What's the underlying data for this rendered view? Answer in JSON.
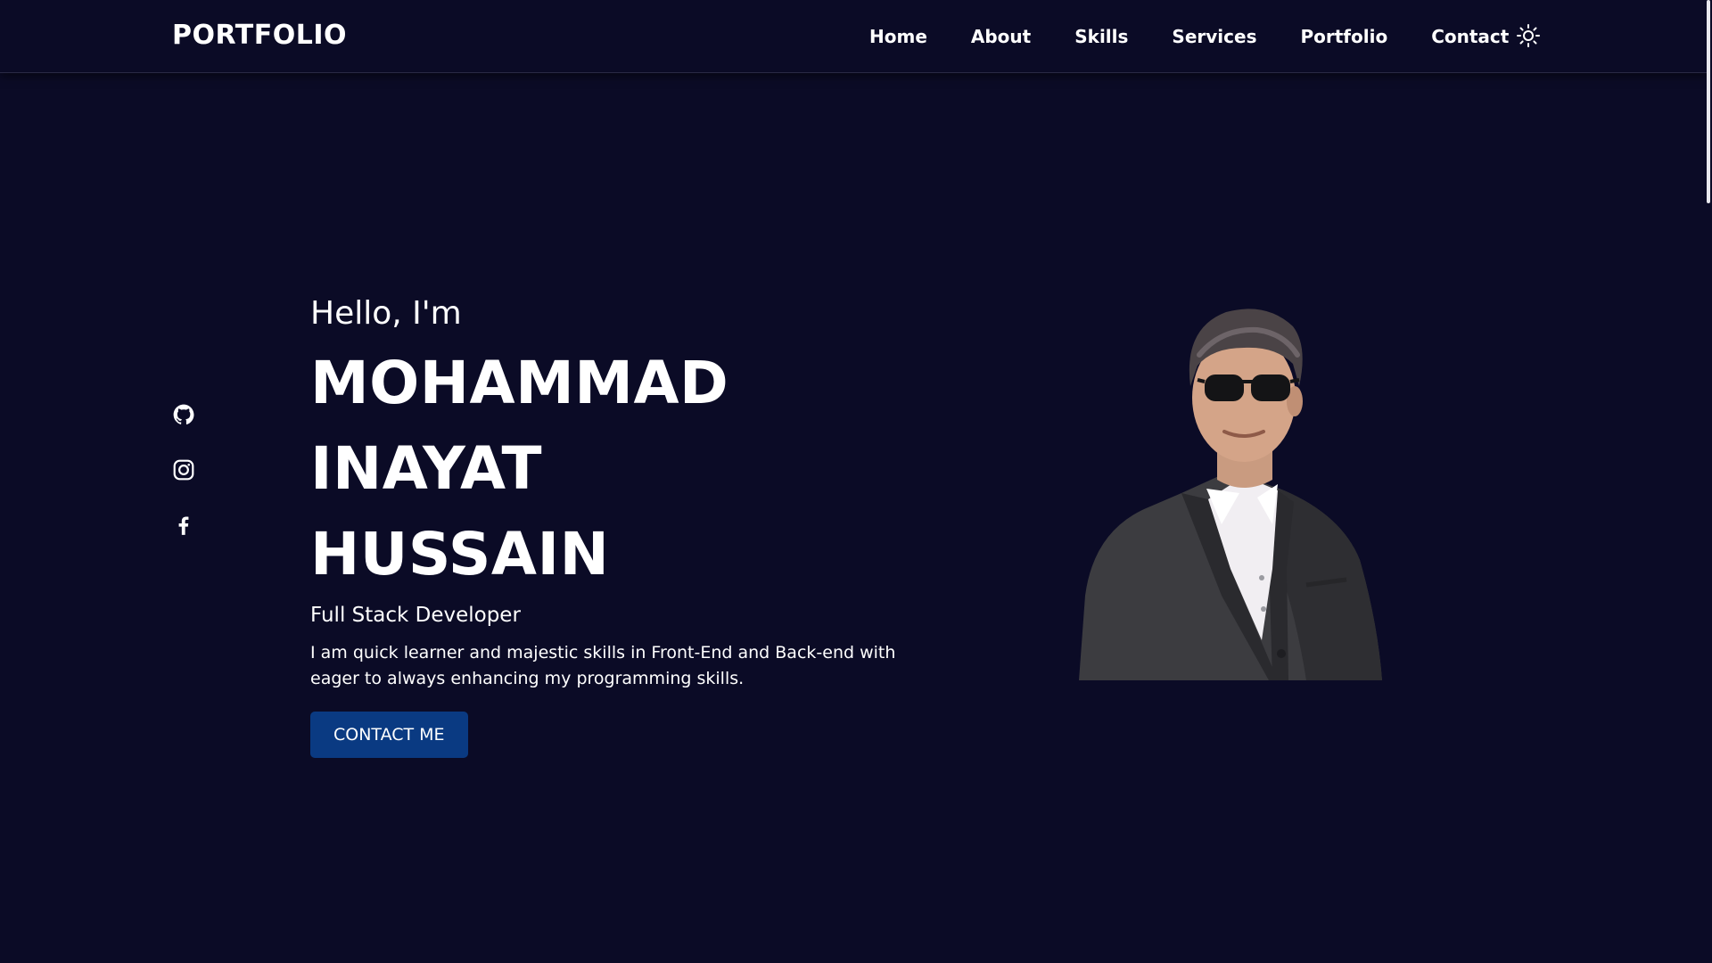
{
  "header": {
    "logo": "PORTFOLIO",
    "nav": [
      {
        "label": "Home"
      },
      {
        "label": "About"
      },
      {
        "label": "Skills"
      },
      {
        "label": "Services"
      },
      {
        "label": "Portfolio"
      },
      {
        "label": "Contact"
      }
    ],
    "theme_toggle_icon": "sun-icon"
  },
  "social": [
    {
      "icon": "github-icon"
    },
    {
      "icon": "instagram-icon"
    },
    {
      "icon": "facebook-icon"
    }
  ],
  "hero": {
    "greeting": "Hello, I'm",
    "name_line1": "MOHAMMAD INAYAT",
    "name_line2": "HUSSAIN",
    "role": "Full Stack Developer",
    "description": "I am quick learner and majestic skills in Front-End and Back-end with eager to always enhancing my programming skills.",
    "cta_label": "CONTACT ME"
  },
  "colors": {
    "background": "#0b0b26",
    "text": "#ffffff",
    "button": "#0a3a82"
  }
}
